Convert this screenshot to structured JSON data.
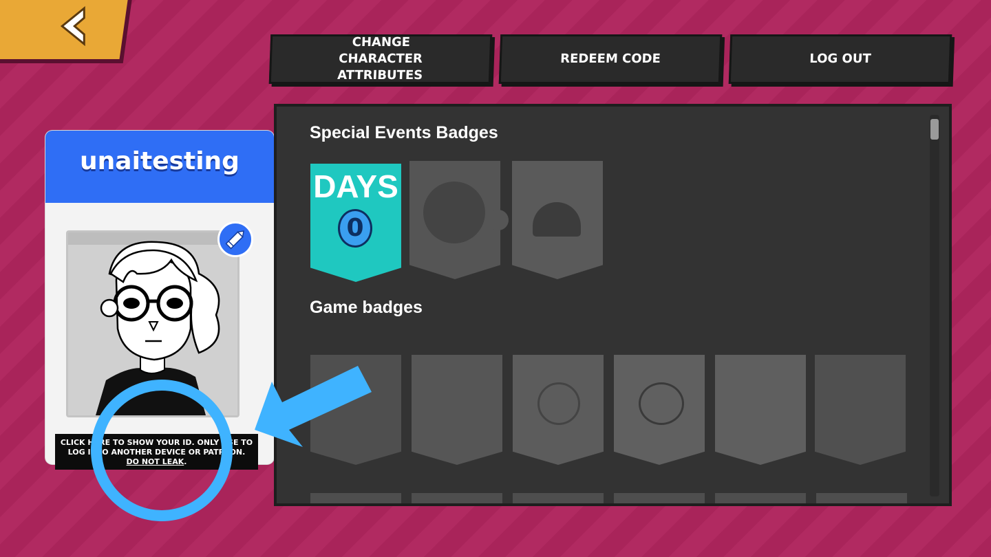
{
  "nav": {
    "back_icon": "back-arrow-icon"
  },
  "top_buttons": {
    "change_attributes": "CHANGE CHARACTER ATTRIBUTES",
    "redeem_code": "REDEEM CODE",
    "log_out": "LOG OUT"
  },
  "profile": {
    "username": "unaitesting",
    "edit_icon": "pencil-icon",
    "id_notice_line1": "CLICK HERE TO SHOW YOUR ID. ONLY USE TO",
    "id_notice_line2": "LOG INTO ANOTHER DEVICE OR PATREON.",
    "id_notice_warning": "DO NOT LEAK"
  },
  "badges": {
    "special_title": "Special Events Badges",
    "days_label": "DAYS",
    "days_count": "0",
    "game_title": "Game badges"
  },
  "colors": {
    "background": "#a9245a",
    "accent_blue": "#2f6ef5",
    "back_button": "#e9a836",
    "days_badge": "#1fc8c0",
    "highlight": "#3fb3ff"
  }
}
